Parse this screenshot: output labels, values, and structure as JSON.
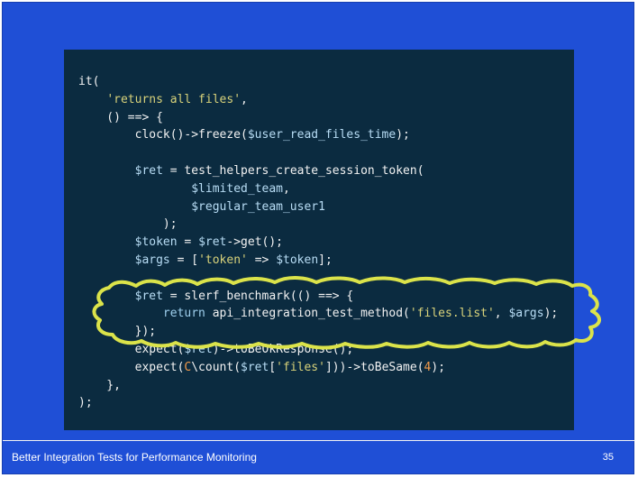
{
  "slide": {
    "footer_title": "Better Integration Tests for Performance Monitoring",
    "page_number": "35"
  },
  "code": {
    "lines": [
      [
        {
          "t": "it("
        }
      ],
      [
        {
          "t": "    "
        },
        {
          "t": "'returns all files'",
          "c": "str"
        },
        {
          "t": ","
        }
      ],
      [
        {
          "t": "    () ==> {"
        }
      ],
      [
        {
          "t": "        clock()->freeze("
        },
        {
          "t": "$user_read_files_time",
          "c": "var"
        },
        {
          "t": ");"
        }
      ],
      [
        {
          "t": ""
        }
      ],
      [
        {
          "t": "        "
        },
        {
          "t": "$ret",
          "c": "var"
        },
        {
          "t": " = test_helpers_create_session_token("
        }
      ],
      [
        {
          "t": "                "
        },
        {
          "t": "$limited_team",
          "c": "var"
        },
        {
          "t": ","
        }
      ],
      [
        {
          "t": "                "
        },
        {
          "t": "$regular_team_user1",
          "c": "var"
        }
      ],
      [
        {
          "t": "            );"
        }
      ],
      [
        {
          "t": "        "
        },
        {
          "t": "$token",
          "c": "var"
        },
        {
          "t": " = "
        },
        {
          "t": "$ret",
          "c": "var"
        },
        {
          "t": "->get();"
        }
      ],
      [
        {
          "t": "        "
        },
        {
          "t": "$args",
          "c": "var"
        },
        {
          "t": " = ["
        },
        {
          "t": "'token'",
          "c": "str"
        },
        {
          "t": " => "
        },
        {
          "t": "$token",
          "c": "var"
        },
        {
          "t": "];"
        }
      ],
      [
        {
          "t": ""
        }
      ],
      [
        {
          "t": "        "
        },
        {
          "t": "$ret",
          "c": "var"
        },
        {
          "t": " = slerf_benchmark(() ==> {"
        }
      ],
      [
        {
          "t": "            "
        },
        {
          "t": "return",
          "c": "kw"
        },
        {
          "t": " api_integration_test_method("
        },
        {
          "t": "'files.list'",
          "c": "str"
        },
        {
          "t": ", "
        },
        {
          "t": "$args",
          "c": "var"
        },
        {
          "t": ");"
        }
      ],
      [
        {
          "t": "        });"
        }
      ],
      [
        {
          "t": "        expect("
        },
        {
          "t": "$ret",
          "c": "var"
        },
        {
          "t": ")->toBeOkResponse();"
        }
      ],
      [
        {
          "t": "        expect("
        },
        {
          "t": "C",
          "c": "cls"
        },
        {
          "t": "\\count("
        },
        {
          "t": "$ret",
          "c": "var"
        },
        {
          "t": "["
        },
        {
          "t": "'files'",
          "c": "str"
        },
        {
          "t": "]))->toBeSame("
        },
        {
          "t": "4",
          "c": "num"
        },
        {
          "t": ");"
        }
      ],
      [
        {
          "t": "    },"
        }
      ],
      [
        {
          "t": ");"
        }
      ]
    ]
  },
  "colors": {
    "slide_background": "#1f4fd6",
    "code_background": "#0b2b40",
    "highlight_stroke": "#dbe34a"
  }
}
